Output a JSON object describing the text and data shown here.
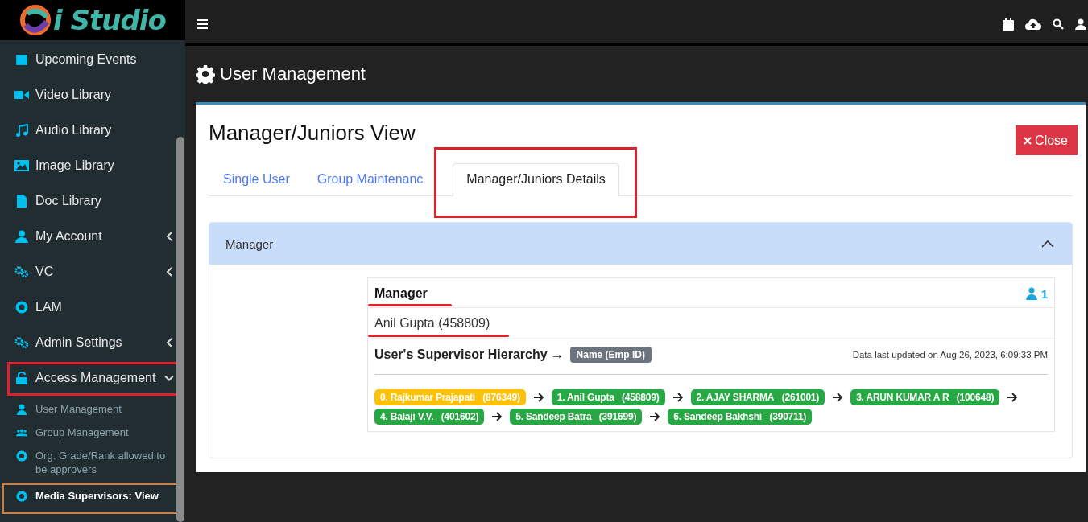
{
  "logo": {
    "text": "i Studio"
  },
  "sidebar": {
    "items": [
      {
        "label": "Upcoming Events"
      },
      {
        "label": "Video Library"
      },
      {
        "label": "Audio Library"
      },
      {
        "label": "Image Library"
      },
      {
        "label": "Doc Library"
      },
      {
        "label": "My Account",
        "expanded": false
      },
      {
        "label": "VC",
        "expanded": false
      },
      {
        "label": "LAM"
      },
      {
        "label": "Admin Settings",
        "expanded": false
      },
      {
        "label": "Access Management",
        "expanded": true,
        "children": [
          {
            "label": "User Management",
            "selected": false
          },
          {
            "label": "Group Management",
            "selected": false
          },
          {
            "label": "Org. Grade/Rank allowed to be approvers",
            "selected": false
          },
          {
            "label": "Media Supervisors: View",
            "selected": true
          }
        ]
      }
    ]
  },
  "page": {
    "title": "User Management"
  },
  "card": {
    "title": "Manager/Juniors View",
    "close_button": "Close",
    "tabs": [
      {
        "label": "Single User",
        "selected": false
      },
      {
        "label": "Group Maintenanc",
        "selected": false
      },
      {
        "label": "Manager/Juniors Details",
        "selected": true
      }
    ],
    "panel": {
      "title": "Manager",
      "expanded": true,
      "box": {
        "title": "Manager",
        "count": "1",
        "manager_name": "Anil Gupta (458809)",
        "hierarchy_label": "User's Supervisor Hierarchy",
        "hierarchy_arrow": "→",
        "legend_badge": "Name (Emp ID)",
        "updated": "Data last updated on Aug 26, 2023, 6:09:33 PM",
        "chain": [
          {
            "name": "0. Rajkumar Prajapati",
            "id": "(876349)",
            "color": "#ffc107"
          },
          {
            "name": "1. Anil Gupta",
            "id": "(458809)",
            "color": "#28a745"
          },
          {
            "name": "2. AJAY SHARMA",
            "id": "(261001)",
            "color": "#28a745"
          },
          {
            "name": "3. ARUN KUMAR A R",
            "id": "(100648)",
            "color": "#28a745"
          },
          {
            "name": "4. Balaji V.V.",
            "id": "(401602)",
            "color": "#28a745"
          },
          {
            "name": "5. Sandeep Batra",
            "id": "(391699)",
            "color": "#28a745"
          },
          {
            "name": "6. Sandeep Bakhshi",
            "id": "(390711)",
            "color": "#28a745"
          }
        ]
      }
    }
  }
}
